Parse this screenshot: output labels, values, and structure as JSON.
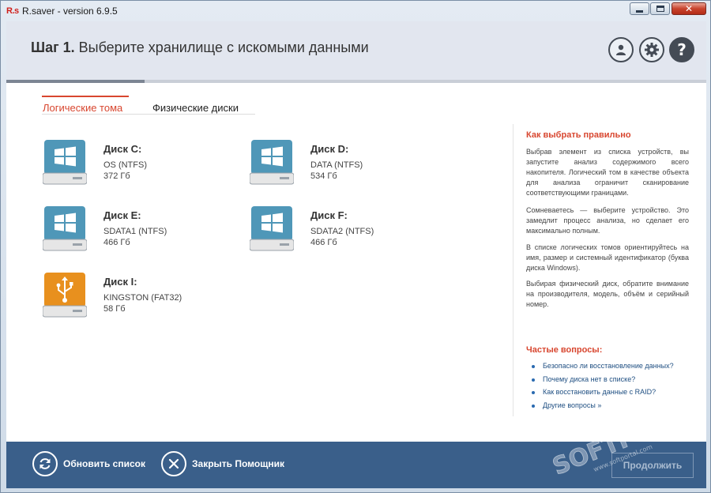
{
  "window": {
    "app_logo": "R.s",
    "title": "R.saver - version 6.9.5"
  },
  "header": {
    "step_number": "Шаг 1.",
    "step_title": "Выберите хранилище с искомыми данными"
  },
  "tabs": [
    {
      "label": "Логические тома",
      "active": true
    },
    {
      "label": "Физические диски",
      "active": false
    }
  ],
  "disks": [
    {
      "name": "Диск C:",
      "label": "OS (NTFS)",
      "size": "372 Гб",
      "icon": "windows-drive-icon"
    },
    {
      "name": "Диск D:",
      "label": "DATA (NTFS)",
      "size": "534 Гб",
      "icon": "windows-drive-icon"
    },
    {
      "name": "Диск E:",
      "label": "SDATA1 (NTFS)",
      "size": "466 Гб",
      "icon": "windows-drive-icon"
    },
    {
      "name": "Диск F:",
      "label": "SDATA2 (NTFS)",
      "size": "466 Гб",
      "icon": "windows-drive-icon"
    },
    {
      "name": "Диск I:",
      "label": "KINGSTON (FAT32)",
      "size": "58 Гб",
      "icon": "usb-drive-icon"
    }
  ],
  "help": {
    "title": "Как выбрать правильно",
    "paragraphs": [
      "Выбрав элемент из списка устройств, вы запустите анализ содержимого всего накопителя. Логический том в качестве объекта для анализа ограничит сканирование соответствующими границами.",
      "Сомневаетесь — выберите устройство. Это замедлит процесс анализа, но сделает его максимально полным.",
      "В списке логических томов ориентируйтесь на имя, размер и системный идентификатор (буква диска Windows).",
      "Выбирая физический диск, обратите внимание на производителя, модель, объём и серийный номер."
    ],
    "faq_title": "Частые вопросы:",
    "faq": [
      "Безопасно ли восстановление данных?",
      "Почему диска нет в списке?",
      "Как восстановить данные с RAID?",
      "Другие вопросы »"
    ]
  },
  "footer": {
    "refresh_label": "Обновить список",
    "close_label": "Закрыть Помощник",
    "continue_label": "Продолжить"
  },
  "watermark": {
    "text": "SOFTPORTAL",
    "sub": "www.softportal.com"
  },
  "colors": {
    "accent": "#d8462f",
    "footer_bg": "#3a5f8a",
    "windows_drive": "#4f97b8",
    "usb_drive": "#e8901e",
    "link": "#1f4f82"
  }
}
